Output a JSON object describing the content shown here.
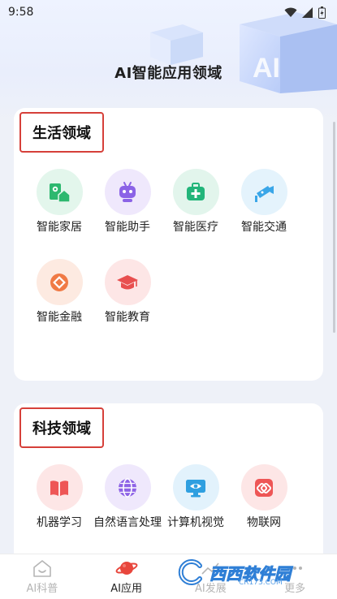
{
  "status_bar": {
    "time": "9:58"
  },
  "page_title": "AI智能应用领域",
  "header_deco_text": "AI",
  "sections": [
    {
      "title": "生活领域",
      "items": [
        {
          "label": "智能家居",
          "icon": "smart-home-icon",
          "color": "#2db86f",
          "bg": "#e3f6ec"
        },
        {
          "label": "智能助手",
          "icon": "robot-icon",
          "color": "#8b63e6",
          "bg": "#efe8fc"
        },
        {
          "label": "智能医疗",
          "icon": "medical-kit-icon",
          "color": "#22b57a",
          "bg": "#e2f5ec"
        },
        {
          "label": "智能交通",
          "icon": "camera-icon",
          "color": "#3aa6e8",
          "bg": "#e4f3fc"
        },
        {
          "label": "智能金融",
          "icon": "coin-icon",
          "color": "#f07a45",
          "bg": "#fdeae1"
        },
        {
          "label": "智能教育",
          "icon": "graduation-cap-icon",
          "color": "#e84f4f",
          "bg": "#fde6e6"
        }
      ]
    },
    {
      "title": "科技领域",
      "items": [
        {
          "label": "机器学习",
          "icon": "book-icon",
          "color": "#ee5656",
          "bg": "#fde6e6"
        },
        {
          "label": "自然语言处理",
          "icon": "globe-icon",
          "color": "#8e63e6",
          "bg": "#efe8fc"
        },
        {
          "label": "计算机视觉",
          "icon": "monitor-eye-icon",
          "color": "#2f9fe0",
          "bg": "#e2f2fc"
        },
        {
          "label": "物联网",
          "icon": "link-icon",
          "color": "#ee5656",
          "bg": "#fde6e6"
        }
      ]
    }
  ],
  "bottom_nav": [
    {
      "label": "AI科普",
      "icon": "house-smile-icon",
      "active": false
    },
    {
      "label": "AI应用",
      "icon": "planet-icon",
      "active": true
    },
    {
      "label": "AI发展",
      "icon": "trend-icon",
      "active": false
    },
    {
      "label": "更多",
      "icon": "more-icon",
      "active": false
    }
  ],
  "watermark": {
    "text": "西西软件园",
    "sub": "CR173.COM"
  },
  "colors": {
    "highlight_border": "#d6403a",
    "background": "#eef1f8"
  }
}
